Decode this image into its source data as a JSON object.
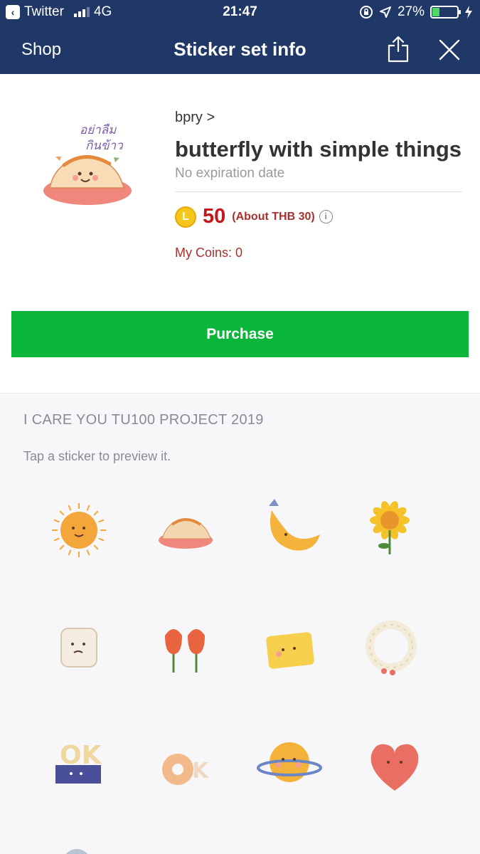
{
  "status_bar": {
    "back_app": "Twitter",
    "network": "4G",
    "time": "21:47",
    "battery": "27%",
    "battery_level": 0.27
  },
  "nav": {
    "back_label": "Shop",
    "title": "Sticker set info"
  },
  "product": {
    "author": "bpry >",
    "name": "butterfly with simple things",
    "expiry": "No expiration date",
    "coin_letter": "L",
    "price": "50",
    "price_approx": "(About THB 30)",
    "my_coins": "My Coins: 0",
    "purchase_label": "Purchase"
  },
  "stickers": {
    "set_title": "I CARE YOU TU100 PROJECT 2019",
    "hint": "Tap a sticker to preview it.",
    "items": [
      {
        "name": "sun-sticker",
        "color": "#f3a73a"
      },
      {
        "name": "omelette-sticker",
        "color": "#f2d7b0"
      },
      {
        "name": "moon-sticker",
        "color": "#f4b33b"
      },
      {
        "name": "sunflower-sticker",
        "color": "#f6c229"
      },
      {
        "name": "toast-sticker",
        "color": "#f5ede2"
      },
      {
        "name": "tulips-sticker",
        "color": "#e8633f"
      },
      {
        "name": "pillow-sticker",
        "color": "#f6d04d"
      },
      {
        "name": "wreath-sticker",
        "color": "#f2ecd8"
      },
      {
        "name": "ok-sticker",
        "color": "#f0d7a2"
      },
      {
        "name": "donut-sticker",
        "color": "#f2b98a"
      },
      {
        "name": "planet-sticker",
        "color": "#f3b23a"
      },
      {
        "name": "heart-sticker",
        "color": "#e96f62"
      }
    ]
  },
  "colors": {
    "header": "#1f3867",
    "purchase": "#0ab639",
    "price": "#c4161c"
  }
}
